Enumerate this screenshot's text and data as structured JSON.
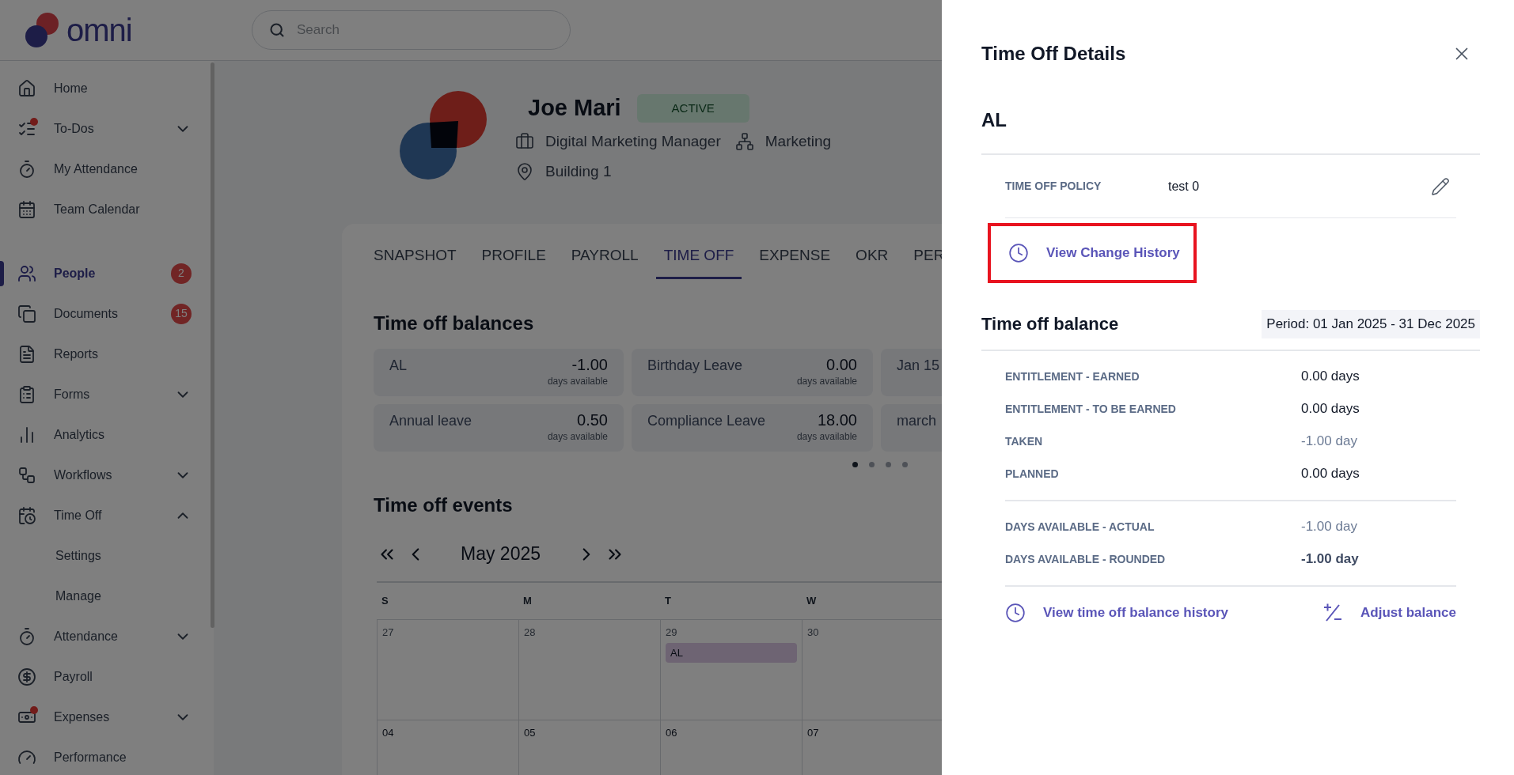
{
  "app": {
    "logo": "omni",
    "search": {
      "placeholder": "Search"
    }
  },
  "sidebar": {
    "sections": [
      {
        "items": [
          {
            "label": "Home",
            "selected": false,
            "notification": false
          },
          {
            "label": "To-Dos",
            "selected": false,
            "notification": true,
            "expanded": false
          },
          {
            "label": "My Attendance",
            "selected": false,
            "notification": false
          },
          {
            "label": "Team Calendar",
            "selected": false,
            "notification": false
          }
        ]
      },
      {
        "items": [
          {
            "label": "People",
            "selected": true,
            "notification": false,
            "badge": "2"
          },
          {
            "label": "Documents",
            "selected": false,
            "notification": false,
            "badge": "15"
          },
          {
            "label": "Reports",
            "selected": false,
            "notification": false
          },
          {
            "label": "Forms",
            "selected": false,
            "notification": false,
            "expanded": false
          },
          {
            "label": "Analytics",
            "selected": false,
            "notification": false
          },
          {
            "label": "Workflows",
            "selected": false,
            "notification": false,
            "expanded": false
          },
          {
            "label": "Time Off",
            "selected": false,
            "notification": false,
            "expanded": true,
            "children": [
              {
                "label": "Settings",
                "selected": false
              },
              {
                "label": "Manage",
                "selected": false
              }
            ]
          },
          {
            "label": "Attendance",
            "selected": false,
            "notification": false,
            "expanded": false
          },
          {
            "label": "Payroll",
            "selected": false,
            "notification": false
          },
          {
            "label": "Expenses",
            "selected": false,
            "notification": true,
            "expanded": false
          },
          {
            "label": "Performance",
            "selected": false,
            "notification": false
          }
        ]
      }
    ]
  },
  "profile": {
    "name": "Joe Mari",
    "status": "ACTIVE",
    "job_title": "Digital Marketing Manager",
    "department": "Marketing",
    "location": "Building 1"
  },
  "tabs": [
    {
      "label": "SNAPSHOT",
      "selected": false
    },
    {
      "label": "PROFILE",
      "selected": false
    },
    {
      "label": "PAYROLL",
      "selected": false
    },
    {
      "label": "TIME OFF",
      "selected": true
    },
    {
      "label": "EXPENSE",
      "selected": false
    },
    {
      "label": "OKR",
      "selected": false
    },
    {
      "label": "PER",
      "selected": false
    }
  ],
  "balances": {
    "title": "Time off balances",
    "cards": [
      {
        "name": "AL",
        "value": "-1.00",
        "unit": "days available"
      },
      {
        "name": "Birthday Leave",
        "value": "0.00",
        "unit": "days available"
      },
      {
        "name": "Jan 15"
      },
      {
        "name": "Annual leave",
        "value": "0.50",
        "unit": "days available"
      },
      {
        "name": "Compliance Leave",
        "value": "18.00",
        "unit": "days available"
      },
      {
        "name": "march"
      }
    ],
    "pages": [
      {
        "selected": true
      },
      {
        "selected": false
      },
      {
        "selected": false
      },
      {
        "selected": false
      }
    ]
  },
  "events": {
    "title": "Time off events",
    "month": "May 2025",
    "weekdays": [
      "S",
      "M",
      "T",
      "W"
    ],
    "weeks": [
      [
        {
          "day": "27"
        },
        {
          "day": "28"
        },
        {
          "day": "29",
          "events": [
            "AL"
          ]
        },
        {
          "day": "30"
        }
      ],
      [
        {
          "day": "04"
        },
        {
          "day": "05"
        },
        {
          "day": "06"
        },
        {
          "day": "07"
        }
      ]
    ]
  },
  "drawer": {
    "title": "Time Off Details",
    "policy_code": "AL",
    "policy": {
      "label": "TIME OFF POLICY",
      "value": "test 0"
    },
    "change_history": {
      "label": "View Change History",
      "highlighted": true
    },
    "balance": {
      "title": "Time off balance",
      "period": "Period: 01 Jan 2025 - 31 Dec 2025",
      "groups": [
        [
          {
            "label": "ENTITLEMENT - EARNED",
            "value": "0.00 days",
            "kind": "plain"
          },
          {
            "label": "ENTITLEMENT - TO BE EARNED",
            "value": "0.00 days",
            "kind": "plain"
          },
          {
            "label": "TAKEN",
            "value": "-1.00 day",
            "kind": "muted"
          },
          {
            "label": "PLANNED",
            "value": "0.00 days",
            "kind": "plain"
          }
        ],
        [
          {
            "label": "DAYS AVAILABLE - ACTUAL",
            "value": "-1.00 day",
            "kind": "muted"
          },
          {
            "label": "DAYS AVAILABLE - ROUNDED",
            "value": "-1.00 day",
            "kind": "strong"
          }
        ]
      ]
    },
    "actions": [
      {
        "label": "View time off balance history",
        "kind": "history"
      },
      {
        "label": "Adjust balance",
        "kind": "adjust"
      }
    ]
  }
}
